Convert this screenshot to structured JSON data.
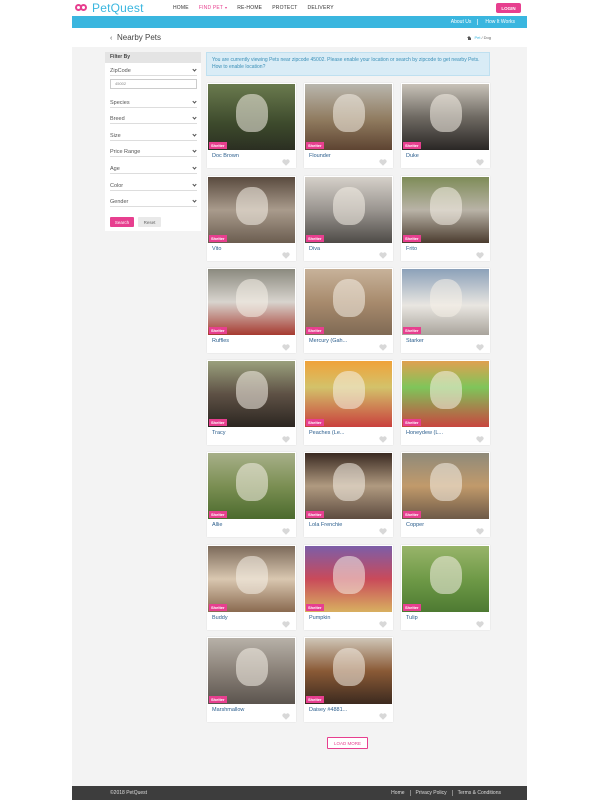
{
  "brand": {
    "name": "PetQuest",
    "primary": "#e73f8f",
    "secondary": "#3ab6df"
  },
  "nav": {
    "items": [
      {
        "label": "HOME",
        "active": false
      },
      {
        "label": "FIND PET",
        "active": true
      },
      {
        "label": "RE-HOME",
        "active": false
      },
      {
        "label": "PROTECT",
        "active": false
      },
      {
        "label": "DELIVERY",
        "active": false
      }
    ],
    "login_label": "LOGIN"
  },
  "subnav": {
    "about_label": "About Us",
    "how_label": "How It Works"
  },
  "header": {
    "title": "Nearby Pets",
    "breadcrumb_pet": "Pet",
    "breadcrumb_sep": "/",
    "breadcrumb_current": "Dog"
  },
  "filter": {
    "heading": "Filter By",
    "zipcode_label": "ZipCode",
    "zip_placeholder": "45002",
    "fields": [
      "Species",
      "Breed",
      "Size",
      "Price Range",
      "Age",
      "Color",
      "Gender"
    ],
    "search_label": "Search",
    "reset_label": "Reset"
  },
  "notice": {
    "text": "You are currently viewing Pets near zipcode 45002. Please enable your location or search by zipcode to get nearby Pets.",
    "link": "How to enable location?"
  },
  "badge_label": "Shelter",
  "pets": [
    {
      "name": "Doc Brown"
    },
    {
      "name": "Flounder"
    },
    {
      "name": "Duke"
    },
    {
      "name": "Vito"
    },
    {
      "name": "Diva"
    },
    {
      "name": "Frito"
    },
    {
      "name": "Ruffles"
    },
    {
      "name": "Mercury (Gah..."
    },
    {
      "name": "Starker"
    },
    {
      "name": "Tracy"
    },
    {
      "name": "Peaches (Le..."
    },
    {
      "name": "Honeydew (L..."
    },
    {
      "name": "Allie"
    },
    {
      "name": "Lola Frenchie"
    },
    {
      "name": "Copper"
    },
    {
      "name": "Buddy"
    },
    {
      "name": "Pumpkin"
    },
    {
      "name": "Tulip"
    },
    {
      "name": "Marshmallow"
    },
    {
      "name": "Daisey #4881..."
    }
  ],
  "load_more_label": "LOAD MORE",
  "footer": {
    "copyright": "©2018 PetQuest",
    "links": [
      "Home",
      "Privacy Policy",
      "Terms & Conditions"
    ]
  }
}
